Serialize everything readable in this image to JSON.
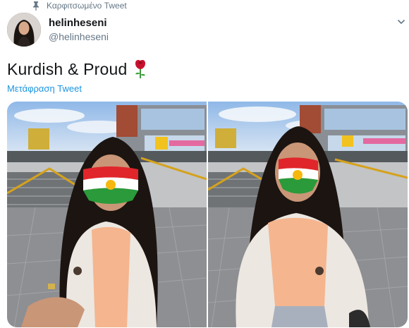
{
  "pinned": {
    "label": "Καρφιτσωμένο Tweet",
    "icon": "pin-icon"
  },
  "author": {
    "name": "helinheseni",
    "handle": "@helinheseni",
    "avatar_icon": "avatar-photo"
  },
  "menu": {
    "icon": "chevron-down-icon"
  },
  "tweet": {
    "text": "Kurdish & Proud",
    "emoji": "rose-icon"
  },
  "translate": {
    "label": "Μετάφραση Tweet"
  },
  "media": {
    "photo_count": 2,
    "photos": [
      "photo-left",
      "photo-right"
    ]
  },
  "colors": {
    "link": "#1b95e0",
    "secondary_text": "#657786",
    "flag_red": "#e0262b",
    "flag_white": "#ffffff",
    "flag_green": "#2a9a3b",
    "flag_sun": "#f6b80f"
  }
}
